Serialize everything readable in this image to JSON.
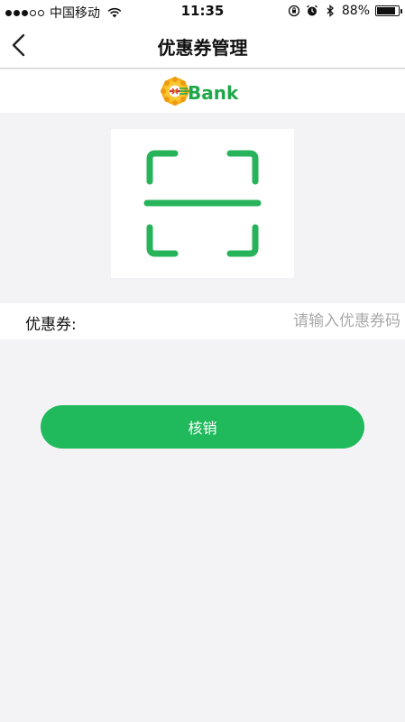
{
  "status_bar": {
    "carrier": "中国移动",
    "time": "11:35",
    "battery_percent": "88%",
    "battery_level": 0.88,
    "icons": [
      "wifi-icon",
      "orientation-lock-icon",
      "alarm-icon",
      "bluetooth-icon",
      "battery-icon"
    ]
  },
  "nav": {
    "title": "优惠券管理",
    "back_icon": "chevron-left-icon"
  },
  "logo": {
    "text": "Bank",
    "brand_color": "#1fa84a"
  },
  "scan": {
    "icon": "scan-icon",
    "color": "#27b35a"
  },
  "coupon": {
    "label": "优惠券:",
    "placeholder": "请输入优惠券码",
    "value": ""
  },
  "actions": {
    "verify_label": "核销",
    "accent": "#20b95b"
  }
}
